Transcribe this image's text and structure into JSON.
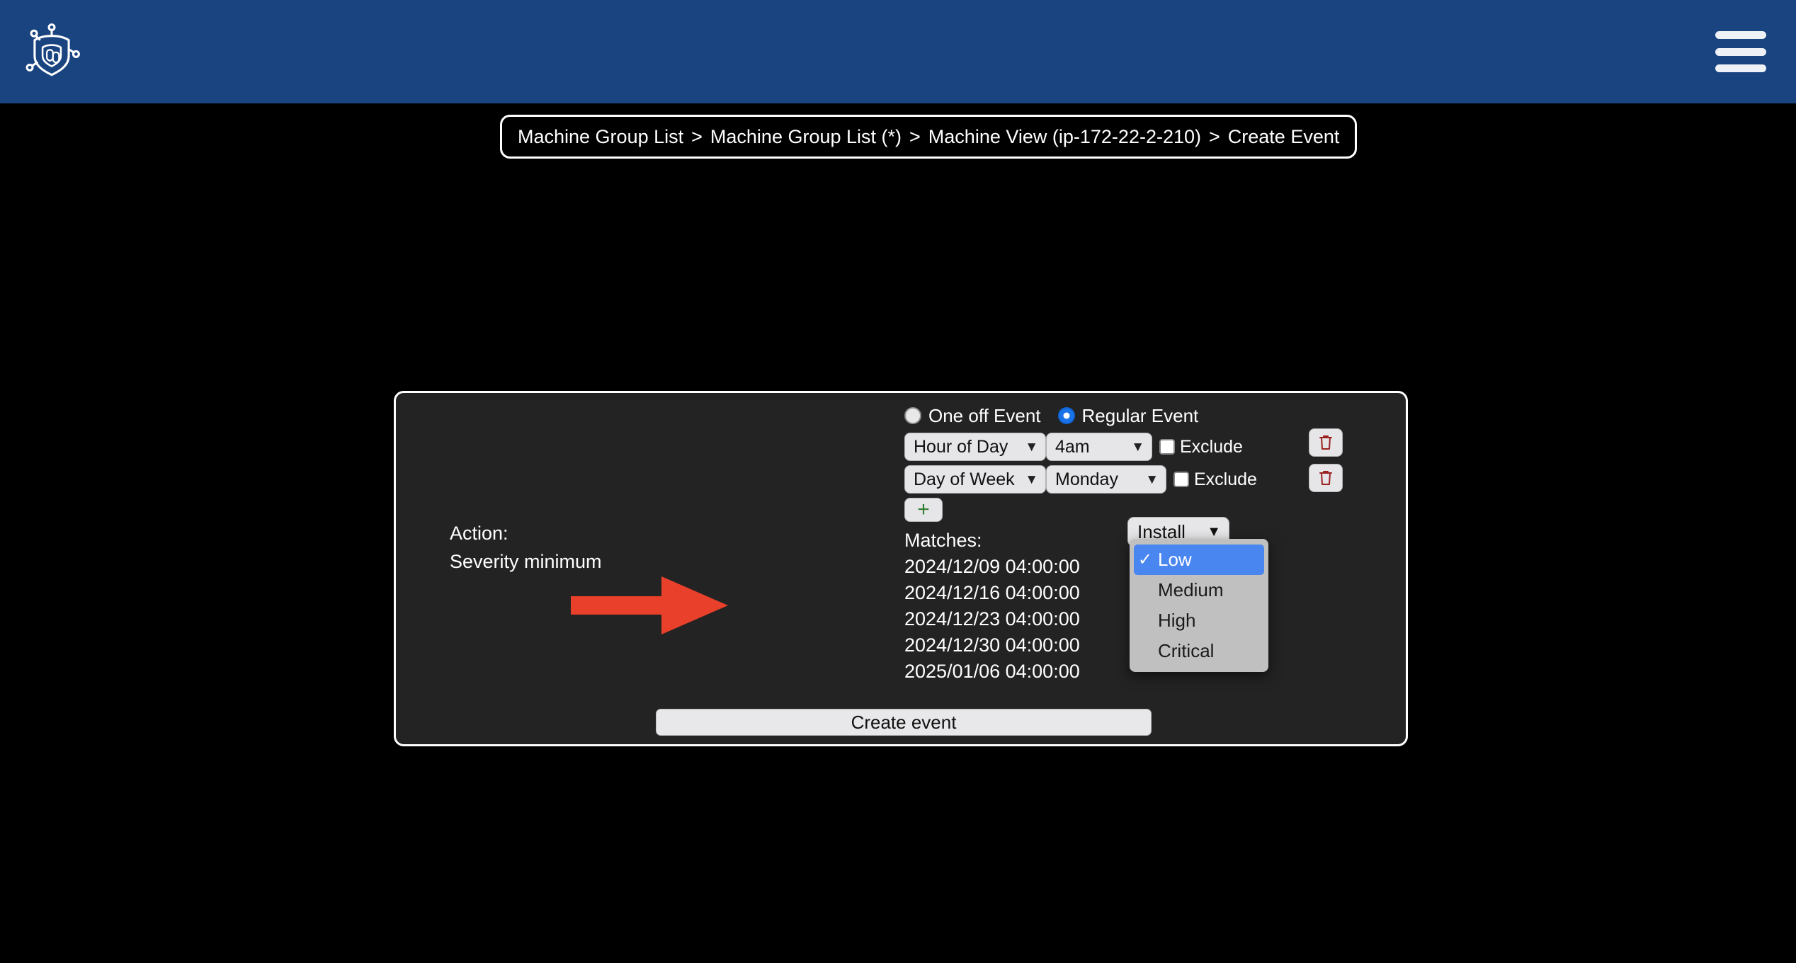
{
  "theme": {
    "header_bg": "#1a4480",
    "page_bg": "#000000",
    "panel_bg": "#232323",
    "accent_blue": "#1a73e8",
    "dropdown_bg": "#c0c0c0",
    "dropdown_selected": "#4a86f0",
    "arrow_color": "#e8402a",
    "trash_color": "#9b2020",
    "add_color": "#2e7d32"
  },
  "header": {
    "logo_name": "shield-circuit-logo",
    "menu_label": "menu"
  },
  "breadcrumb": {
    "separator": ">",
    "items": [
      "Machine Group List",
      "Machine Group List (*)",
      "Machine View (ip-172-22-2-210)",
      "Create Event"
    ]
  },
  "panel": {
    "event_type": {
      "options": [
        {
          "label": "One off Event",
          "selected": false
        },
        {
          "label": "Regular Event",
          "selected": true
        }
      ]
    },
    "conditions": [
      {
        "type_value": "Hour of Day",
        "detail_value": "4am",
        "exclude_label": "Exclude",
        "exclude_checked": false,
        "delete_label": "delete"
      },
      {
        "type_value": "Day of Week",
        "detail_value": "Monday",
        "exclude_label": "Exclude",
        "exclude_checked": false,
        "delete_label": "delete"
      }
    ],
    "add_condition_label": "+",
    "form": {
      "action_label": "Action:",
      "severity_label": "Severity minimum",
      "action_value": "Install"
    },
    "severity_dropdown": {
      "open": true,
      "check_glyph": "✓",
      "options": [
        {
          "label": "Low",
          "selected": true
        },
        {
          "label": "Medium",
          "selected": false
        },
        {
          "label": "High",
          "selected": false
        },
        {
          "label": "Critical",
          "selected": false
        }
      ]
    },
    "matches": {
      "title": "Matches:",
      "values": [
        "2024/12/09 04:00:00",
        "2024/12/16 04:00:00",
        "2024/12/23 04:00:00",
        "2024/12/30 04:00:00",
        "2025/01/06 04:00:00"
      ]
    },
    "submit_label": "Create event"
  },
  "annotation": {
    "arrow_name": "red-pointer-arrow",
    "points_to": "Severity minimum dropdown"
  }
}
